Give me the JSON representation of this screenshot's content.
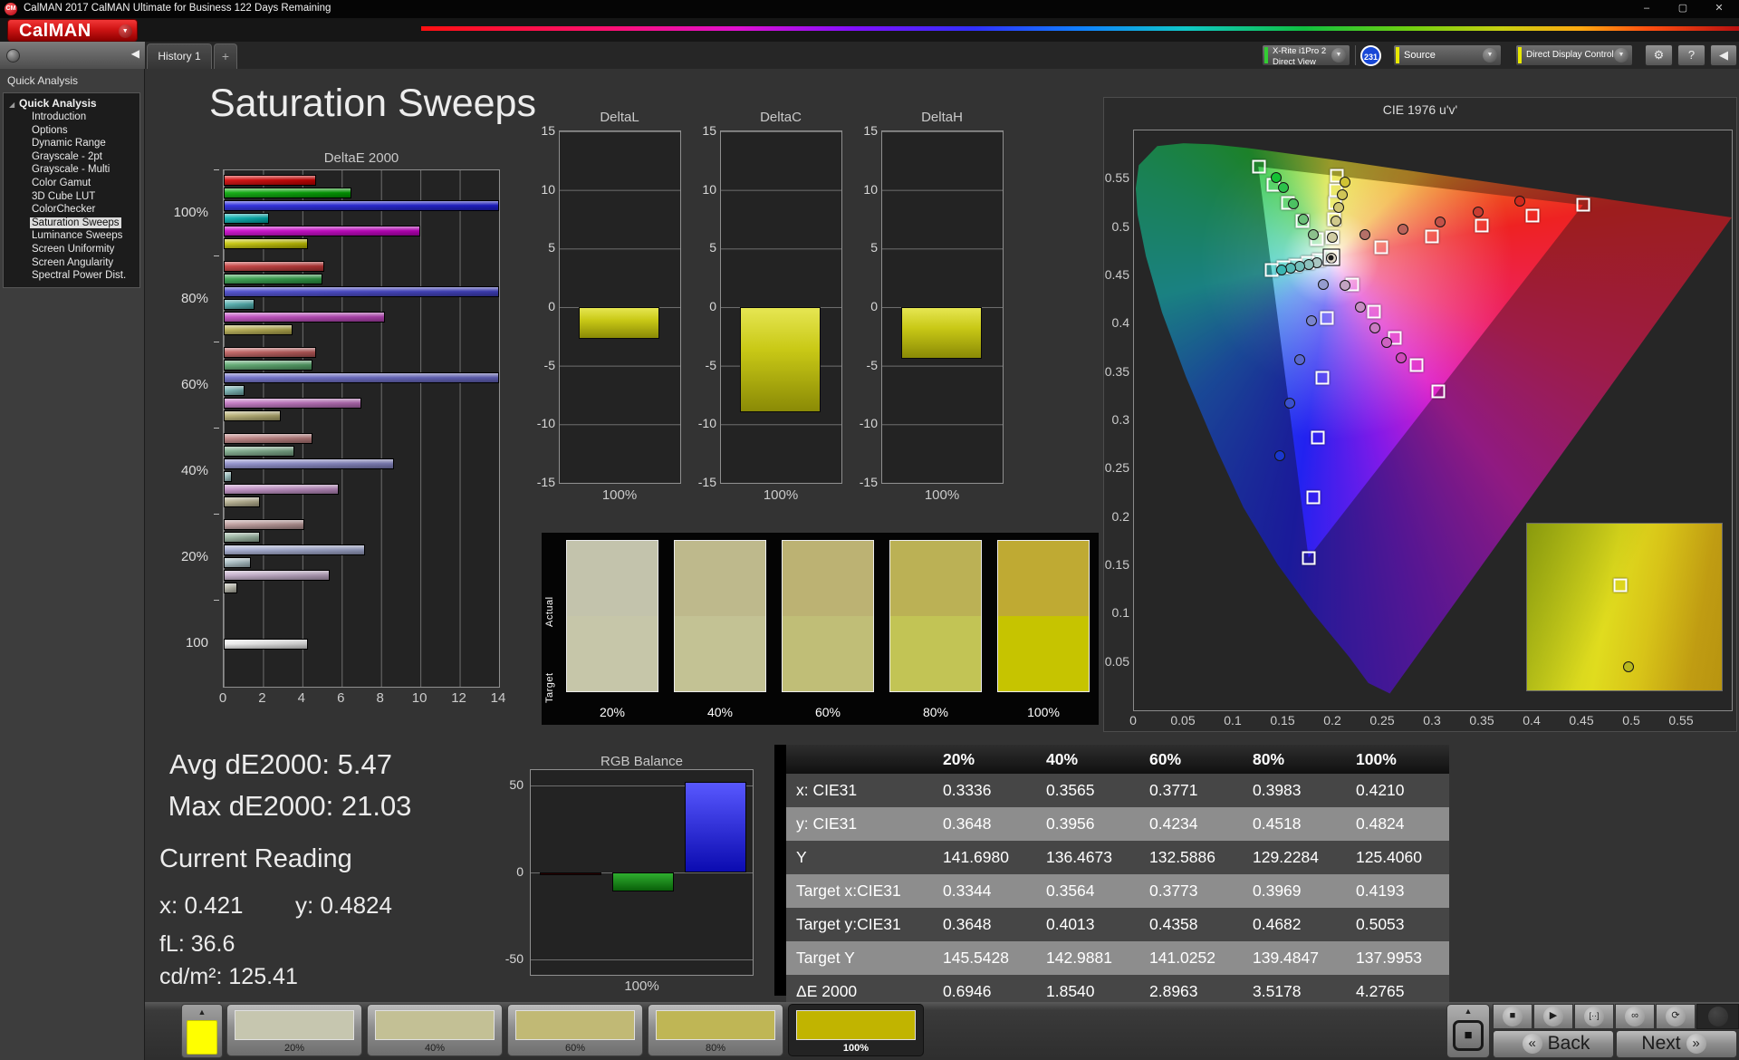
{
  "window": {
    "title": "CalMAN 2017 CalMAN Ultimate for Business 122 Days Remaining",
    "minimize": "–",
    "maximize": "▢",
    "close": "✕"
  },
  "icons": {
    "app_monogram": "CM",
    "dropdown_arrow": "▼",
    "collapse_left": "◀",
    "tree_expand": "◢",
    "gear": "⚙",
    "help": "?",
    "up_arrow": "▲",
    "stop": "■",
    "play": "▶",
    "series": "[··]",
    "infinity": "∞",
    "loop": "⟳",
    "back_chevron": "«",
    "next_chevron": "»"
  },
  "brand": {
    "logo_text": "CalMAN"
  },
  "tab_bar": {
    "history_tab": "History 1",
    "add_tab": "+"
  },
  "toolbar": {
    "meter_line1": "X-Rite i1Pro 2",
    "meter_line2": "Direct View",
    "meter_accent": "#33cc33",
    "badge": "231",
    "source_label": "Source",
    "source_accent": "#e8e800",
    "display_label": "Direct Display Control",
    "display_accent": "#e8e800"
  },
  "sidebar": {
    "header": "Quick Analysis",
    "tree_root": "Quick Analysis",
    "items": [
      "Introduction",
      "Options",
      "Dynamic Range",
      "Grayscale - 2pt",
      "Grayscale - Multi",
      "Color Gamut",
      "3D Cube LUT",
      "ColorChecker",
      "Saturation Sweeps",
      "Luminance Sweeps",
      "Screen Uniformity",
      "Screen Angularity",
      "Spectral Power Dist."
    ],
    "selected_index": 8
  },
  "main": {
    "title": "Saturation Sweeps"
  },
  "summary": {
    "avg": "Avg dE2000: 5.47",
    "max": "Max dE2000: 21.03",
    "heading": "Current Reading",
    "x": "x: 0.421",
    "y": "y: 0.4824",
    "fl": "fL: 36.6",
    "cd": "cd/m²: 125.41"
  },
  "chart_data": [
    {
      "id": "deltae2000",
      "type": "bar",
      "orientation": "horizontal",
      "title": "DeltaE 2000",
      "xlim": [
        0,
        14
      ],
      "xticks": [
        0,
        2,
        4,
        6,
        8,
        10,
        12,
        14
      ],
      "grid": true,
      "groups": [
        {
          "label": "100%",
          "colors": [
            "#d40000",
            "#00a800",
            "#2020dd",
            "#00b0b0",
            "#cc00cc",
            "#c6c600"
          ],
          "values": [
            4.7,
            6.5,
            21.0,
            2.3,
            10.0,
            4.28
          ]
        },
        {
          "label": "80%",
          "colors": [
            "#c43838",
            "#30a048",
            "#4444cc",
            "#50b0b0",
            "#c048c0",
            "#bab050"
          ],
          "values": [
            5.1,
            5.0,
            18.0,
            1.55,
            8.2,
            3.52
          ]
        },
        {
          "label": "60%",
          "colors": [
            "#c05c5c",
            "#58a86c",
            "#6a6ac8",
            "#78b6b6",
            "#c273c2",
            "#b8b072"
          ],
          "values": [
            4.7,
            4.5,
            16.0,
            1.05,
            7.0,
            2.9
          ]
        },
        {
          "label": "40%",
          "colors": [
            "#bf8181",
            "#7fae8d",
            "#8b8bca",
            "#9cc2c2",
            "#c492c9",
            "#b9b392"
          ],
          "values": [
            4.5,
            3.6,
            8.65,
            0.4,
            5.85,
            1.85
          ]
        },
        {
          "label": "20%",
          "colors": [
            "#bf9c9c",
            "#9cb8a4",
            "#a6aed4",
            "#aec4ca",
            "#c4aecb",
            "#bcbcae"
          ],
          "values": [
            4.1,
            1.85,
            7.2,
            1.4,
            5.4,
            0.69
          ]
        },
        {
          "label": "100",
          "colors": [
            "#ececec"
          ],
          "values": [
            4.3
          ]
        }
      ]
    },
    {
      "id": "deltaL",
      "type": "bar",
      "title": "DeltaL",
      "categories": [
        "100%"
      ],
      "values": [
        -2.7
      ],
      "ylim": [
        -15,
        15
      ],
      "yticks": [
        15,
        10,
        5,
        0,
        -5,
        -10,
        -15
      ]
    },
    {
      "id": "deltaC",
      "type": "bar",
      "title": "DeltaC",
      "categories": [
        "100%"
      ],
      "values": [
        -9.0
      ],
      "ylim": [
        -15,
        15
      ],
      "yticks": [
        15,
        10,
        5,
        0,
        -5,
        -10,
        -15
      ]
    },
    {
      "id": "deltaH",
      "type": "bar",
      "title": "DeltaH",
      "categories": [
        "100%"
      ],
      "values": [
        -4.4
      ],
      "ylim": [
        -15,
        15
      ],
      "yticks": [
        15,
        10,
        5,
        0,
        -5,
        -10,
        -15
      ]
    },
    {
      "id": "rgb_balance",
      "type": "bar",
      "title": "RGB Balance",
      "categories": [
        "100%"
      ],
      "ylim": [
        -59,
        59
      ],
      "yticks": [
        50,
        0,
        -50
      ],
      "series": [
        {
          "name": "red",
          "value": -0.8,
          "color": "#2a0000",
          "gradient_top": "#3a0000",
          "gradient_bottom": "#180000"
        },
        {
          "name": "green",
          "value": -11,
          "color": "#128a12",
          "gradient_top": "#2fae2f",
          "gradient_bottom": "#096009"
        },
        {
          "name": "blue",
          "value": 52,
          "color": "#1414e0",
          "gradient_top": "#5858ff",
          "gradient_bottom": "#0b0bb0"
        }
      ]
    },
    {
      "id": "cie",
      "type": "scatter",
      "title": "CIE 1976 u'v'",
      "range": [
        0,
        0.6
      ],
      "xticks": [
        0,
        0.05,
        0.1,
        0.15,
        0.2,
        0.25,
        0.3,
        0.35,
        0.4,
        0.45,
        0.5,
        0.55
      ],
      "yticks": [
        0,
        0.05,
        0.1,
        0.15,
        0.2,
        0.25,
        0.3,
        0.35,
        0.4,
        0.45,
        0.5,
        0.55
      ],
      "white_point": {
        "u": 0.1978,
        "v": 0.4683
      },
      "targets": [
        {
          "u": 0.2484,
          "v": 0.4792
        },
        {
          "u": 0.299,
          "v": 0.4901
        },
        {
          "u": 0.3495,
          "v": 0.5011
        },
        {
          "u": 0.4001,
          "v": 0.512
        },
        {
          "u": 0.4507,
          "v": 0.5229
        },
        {
          "u": 0.1832,
          "v": 0.4871
        },
        {
          "u": 0.1687,
          "v": 0.506
        },
        {
          "u": 0.1541,
          "v": 0.5248
        },
        {
          "u": 0.1396,
          "v": 0.5437
        },
        {
          "u": 0.125,
          "v": 0.5625
        },
        {
          "u": 0.1933,
          "v": 0.4062
        },
        {
          "u": 0.1888,
          "v": 0.3441
        },
        {
          "u": 0.1844,
          "v": 0.2821
        },
        {
          "u": 0.1799,
          "v": 0.22
        },
        {
          "u": 0.1754,
          "v": 0.1579
        },
        {
          "u": 0.1859,
          "v": 0.4658
        },
        {
          "u": 0.1741,
          "v": 0.4633
        },
        {
          "u": 0.1622,
          "v": 0.4607
        },
        {
          "u": 0.1504,
          "v": 0.4582
        },
        {
          "u": 0.1385,
          "v": 0.4557
        },
        {
          "u": 0.2192,
          "v": 0.4406
        },
        {
          "u": 0.2407,
          "v": 0.4129
        },
        {
          "u": 0.2621,
          "v": 0.3852
        },
        {
          "u": 0.2836,
          "v": 0.3575
        },
        {
          "u": 0.305,
          "v": 0.3298
        },
        {
          "u": 0.1994,
          "v": 0.4894
        },
        {
          "u": 0.2007,
          "v": 0.5085
        },
        {
          "u": 0.2019,
          "v": 0.5247
        },
        {
          "u": 0.2029,
          "v": 0.5385
        },
        {
          "u": 0.2039,
          "v": 0.5529
        }
      ],
      "measurements": [
        {
          "u": 0.198,
          "v": 0.468,
          "color": "#ded8c8"
        },
        {
          "u": 0.232,
          "v": 0.492,
          "color": "#b47068"
        },
        {
          "u": 0.27,
          "v": 0.4975,
          "color": "#bb625a"
        },
        {
          "u": 0.307,
          "v": 0.5055,
          "color": "#c25148"
        },
        {
          "u": 0.345,
          "v": 0.5155,
          "color": "#c93d32"
        },
        {
          "u": 0.387,
          "v": 0.527,
          "color": "#d02a1e"
        },
        {
          "u": 0.18,
          "v": 0.4925,
          "color": "#8cc18c"
        },
        {
          "u": 0.17,
          "v": 0.5085,
          "color": "#6cc17a"
        },
        {
          "u": 0.16,
          "v": 0.5245,
          "color": "#4cc162"
        },
        {
          "u": 0.15,
          "v": 0.5405,
          "color": "#2cc14a"
        },
        {
          "u": 0.143,
          "v": 0.5515,
          "color": "#14c134"
        },
        {
          "u": 0.19,
          "v": 0.441,
          "color": "#959cce"
        },
        {
          "u": 0.178,
          "v": 0.403,
          "color": "#7a84ce"
        },
        {
          "u": 0.166,
          "v": 0.363,
          "color": "#5a68ce"
        },
        {
          "u": 0.156,
          "v": 0.318,
          "color": "#3a50ce"
        },
        {
          "u": 0.146,
          "v": 0.263,
          "color": "#1a38ce"
        },
        {
          "u": 0.184,
          "v": 0.4635,
          "color": "#aac6c2"
        },
        {
          "u": 0.175,
          "v": 0.4615,
          "color": "#8ec2be"
        },
        {
          "u": 0.166,
          "v": 0.4595,
          "color": "#72beba"
        },
        {
          "u": 0.157,
          "v": 0.4575,
          "color": "#56bab6"
        },
        {
          "u": 0.148,
          "v": 0.456,
          "color": "#3ab6b2"
        },
        {
          "u": 0.212,
          "v": 0.44,
          "color": "#c2a2c2"
        },
        {
          "u": 0.227,
          "v": 0.417,
          "color": "#c68ec2"
        },
        {
          "u": 0.242,
          "v": 0.396,
          "color": "#ca7ac2"
        },
        {
          "u": 0.254,
          "v": 0.381,
          "color": "#ce62c2"
        },
        {
          "u": 0.268,
          "v": 0.365,
          "color": "#ce4aba"
        },
        {
          "u": 0.1989,
          "v": 0.4893,
          "color": "#d0cca2"
        },
        {
          "u": 0.2027,
          "v": 0.5062,
          "color": "#d0c98c"
        },
        {
          "u": 0.2059,
          "v": 0.5201,
          "color": "#d0c772"
        },
        {
          "u": 0.2089,
          "v": 0.5333,
          "color": "#d0c556"
        },
        {
          "u": 0.2119,
          "v": 0.5463,
          "color": "#d0c334"
        }
      ],
      "inset": {
        "square": {
          "x": 0.48,
          "y": 0.37
        },
        "circle": {
          "x": 0.52,
          "y": 0.86,
          "color": "#b8b81e"
        }
      }
    }
  ],
  "swatch_compare": {
    "row_labels": [
      "Actual",
      "Target"
    ],
    "columns": [
      {
        "label": "20%",
        "actual": "#c3c3ac",
        "target": "#c6c6a9"
      },
      {
        "label": "40%",
        "actual": "#beb98c",
        "target": "#c3c294"
      },
      {
        "label": "60%",
        "actual": "#bcb273",
        "target": "#c0be77"
      },
      {
        "label": "80%",
        "actual": "#bbb155",
        "target": "#c2c455"
      },
      {
        "label": "100%",
        "actual": "#bfaa33",
        "target": "#c6c400"
      }
    ]
  },
  "table": {
    "col_headers": [
      "20%",
      "40%",
      "60%",
      "80%",
      "100%"
    ],
    "rows": [
      {
        "label": "x: CIE31",
        "values": [
          "0.3336",
          "0.3565",
          "0.3771",
          "0.3983",
          "0.4210"
        ]
      },
      {
        "label": "y: CIE31",
        "values": [
          "0.3648",
          "0.3956",
          "0.4234",
          "0.4518",
          "0.4824"
        ]
      },
      {
        "label": "Y",
        "values": [
          "141.6980",
          "136.4673",
          "132.5886",
          "129.2284",
          "125.4060"
        ]
      },
      {
        "label": "Target x:CIE31",
        "values": [
          "0.3344",
          "0.3564",
          "0.3773",
          "0.3969",
          "0.4193"
        ]
      },
      {
        "label": "Target y:CIE31",
        "values": [
          "0.3648",
          "0.4013",
          "0.4358",
          "0.4682",
          "0.5053"
        ]
      },
      {
        "label": "Target Y",
        "values": [
          "145.5428",
          "142.9881",
          "141.0252",
          "139.4847",
          "137.9953"
        ]
      },
      {
        "label": "ΔE 2000",
        "values": [
          "0.6946",
          "1.8540",
          "2.8963",
          "3.5178",
          "4.2765"
        ]
      }
    ]
  },
  "bottom_bar": {
    "mini_swatch_color": "#ffff00",
    "swatches": [
      {
        "label": "20%",
        "color": "#c6c6af",
        "selected": false
      },
      {
        "label": "40%",
        "color": "#c3c095",
        "selected": false
      },
      {
        "label": "60%",
        "color": "#c1b975",
        "selected": false
      },
      {
        "label": "80%",
        "color": "#bfb655",
        "selected": false
      },
      {
        "label": "100%",
        "color": "#c1b400",
        "selected": true
      }
    ],
    "back_label": "Back",
    "next_label": "Next"
  }
}
